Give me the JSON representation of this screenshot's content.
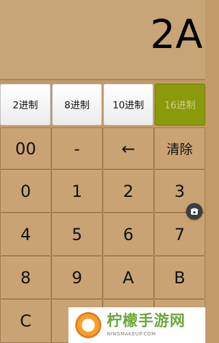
{
  "display": {
    "value": "2A"
  },
  "modes": [
    "2进制",
    "8进制",
    "10进制",
    "16进制"
  ],
  "active_mode": "16进制",
  "keys": {
    "row1": [
      "00",
      "-",
      "←",
      "清除"
    ],
    "row2": [
      "0",
      "1",
      "2",
      "3"
    ],
    "row3": [
      "4",
      "5",
      "6",
      "7"
    ],
    "row4": [
      "8",
      "9",
      "A",
      "B"
    ],
    "row5": [
      "C",
      "",
      "",
      ""
    ]
  },
  "floating_button_icon": "phone-icon",
  "watermark": {
    "title": "柠檬手游网",
    "url": "NINGMAKEUP.COM",
    "logo_icon": "lemon-logo-icon"
  },
  "colors": {
    "background": "#c29a68",
    "key": "#c9a373",
    "active_mode": "#8a9a0a"
  }
}
